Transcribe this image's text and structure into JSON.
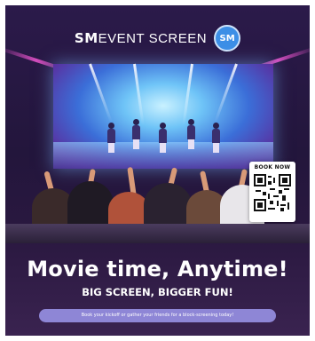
{
  "header": {
    "brand_strong": "SM",
    "brand_light": "EVENT SCREEN",
    "logo_text": "SM"
  },
  "qr": {
    "label": "BOOK NOW"
  },
  "headline": "Movie time, Anytime!",
  "subheadline": "BIG SCREEN, BIGGER FUN!",
  "cta_text": "Book your kickoff or gather your friends for a block-screening today!",
  "colors": {
    "background_top": "#2b1a4a",
    "background_bottom": "#3a2350",
    "cta_pill": "#8e86d6",
    "logo_badge": "#3d8fe6",
    "text": "#ffffff"
  },
  "icons": {
    "logo": "sm-circle-logo",
    "qr": "qr-code-icon"
  }
}
